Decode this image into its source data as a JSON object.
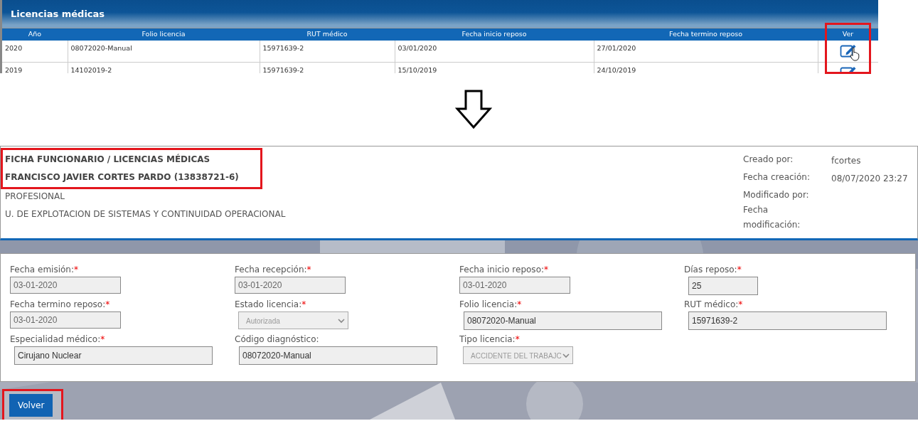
{
  "licencias_panel": {
    "title": "Licencias médicas",
    "table": {
      "ver_column_highlighted": true,
      "columns": [
        "Año",
        "Folio licencia",
        "RUT médico",
        "Fecha inicio reposo",
        "Fecha termino reposo",
        "Ver"
      ],
      "rows": [
        {
          "cells": [
            "2020",
            "08072020-Manual",
            "15971639-2",
            "03/01/2020",
            "27/01/2020"
          ],
          "pointer": true
        },
        {
          "cells": [
            "2019",
            "14102019-2",
            "15971639-2",
            "15/10/2019",
            "24/10/2019"
          ],
          "pointer": false
        }
      ]
    }
  },
  "employee_panel": {
    "highlighted": true,
    "breadcrumb": "FICHA FUNCIONARIO / LICENCIAS MÉDICAS",
    "name": "FRANCISCO JAVIER CORTES PARDO (13838721-6)",
    "position": "PROFESIONAL",
    "unit": "U. DE EXPLOTACION DE SISTEMAS Y CONTINUIDAD OPERACIONAL",
    "meta": [
      {
        "label": "Creado por:",
        "value": "fcortes"
      },
      {
        "label": "Fecha creación:",
        "value": "08/07/2020 23:27"
      },
      {
        "label": "Modificado por:"
      },
      {
        "label": "Fecha modificación:"
      }
    ]
  },
  "form": {
    "fields": [
      {
        "label": "Fecha emisión:",
        "mark": "*",
        "kind": "input",
        "value": "03-01-2020",
        "disabled": false
      },
      {
        "label": "Fecha recepción:",
        "mark": "*",
        "kind": "input",
        "value": "03-01-2020",
        "disabled": false
      },
      {
        "label": "Fecha inicio reposo:",
        "mark": "*",
        "kind": "input",
        "value": "03-01-2020",
        "disabled": false
      },
      {
        "label": "Días reposo:",
        "mark": "*",
        "kind": "input",
        "value": "25",
        "disabled": false
      },
      {
        "label": "Fecha termino reposo:",
        "mark": "*",
        "kind": "input",
        "value": "03-01-2020",
        "disabled": false
      },
      {
        "label": "Estado licencia:",
        "mark": "*",
        "kind": "select",
        "value": "Autorizada",
        "disabled": true
      },
      {
        "label": "Folio licencia:",
        "mark": "*",
        "kind": "input",
        "value": "08072020-Manual",
        "disabled": false
      },
      {
        "label": "RUT médico:",
        "mark": "*",
        "kind": "input",
        "value": "15971639-2",
        "disabled": false
      },
      {
        "label": "Especialidad médico:",
        "mark": "*",
        "kind": "input",
        "value": "Cirujano Nuclear",
        "disabled": false
      },
      {
        "label": "Código diagnóstico:",
        "kind": "input",
        "value": "08072020-Manual",
        "disabled": false
      },
      {
        "label": "Tipo licencia:",
        "mark": "*",
        "kind": "select",
        "value": "ACCIDENTE DEL TRABAJC",
        "disabled": true
      }
    ]
  },
  "back_button": {
    "label": "Volver",
    "highlighted": true
  }
}
